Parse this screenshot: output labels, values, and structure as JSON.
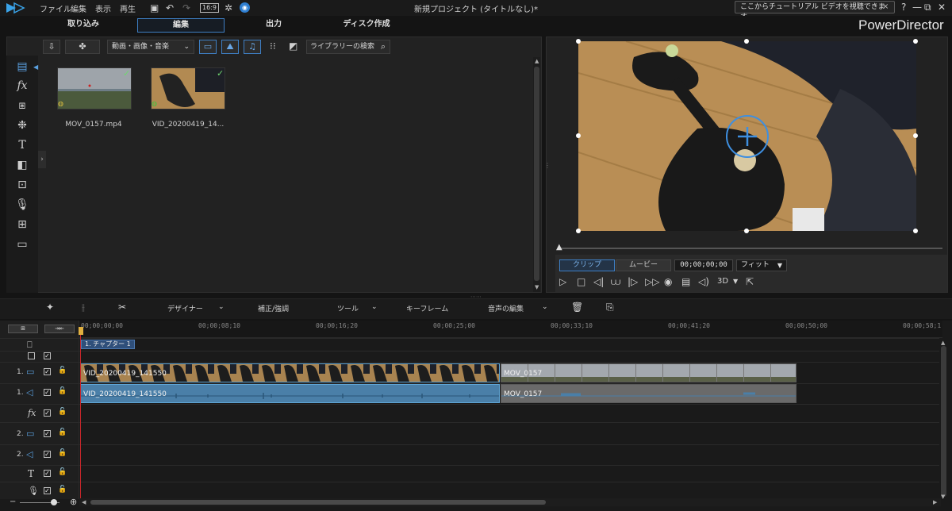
{
  "menu": [
    "ファイル",
    "編集",
    "表示",
    "再生"
  ],
  "window_title": "新規プロジェクト (タイトルなし)*",
  "tutorial": {
    "text": "ここからチュートリアル ビデオを視聴できます。",
    "close": "×"
  },
  "window_controls": {
    "help": "?",
    "minimize": "—",
    "restore": "⧉",
    "close": "✕"
  },
  "aspect_ratio": "16:9",
  "modes": [
    "取り込み",
    "編集",
    "出力",
    "ディスク作成"
  ],
  "brand": "PowerDirector",
  "library": {
    "filter_label": "動画・画像・音楽",
    "search_placeholder": "ライブラリーの検索",
    "items": [
      {
        "label": "MOV_0157.mp4"
      },
      {
        "label": "VID_20200419_14..."
      }
    ]
  },
  "preview": {
    "clip_tab": "クリップ",
    "movie_tab": "ムービー",
    "timecode": "00;00;00;00",
    "fit": "フィット",
    "mode_3d": "3D"
  },
  "edit_toolbar": {
    "designer": "デザイナー",
    "correction": "補正/強調",
    "tools": "ツール",
    "keyframe": "キーフレーム",
    "audio_edit": "音声の編集"
  },
  "timeline": {
    "ruler_labels": [
      "00;00;00;00",
      "00;00;08;10",
      "00;00;16;20",
      "00;00;25;00",
      "00;00;33;10",
      "00;00;41;20",
      "00;00;50;00",
      "00;00;58;1"
    ],
    "chapter": "1. チャプター 1",
    "tracks": [
      {
        "num": "1.",
        "type": "video"
      },
      {
        "num": "1.",
        "type": "audio"
      },
      {
        "num": "",
        "type": "fx"
      },
      {
        "num": "2.",
        "type": "video"
      },
      {
        "num": "2.",
        "type": "audio"
      },
      {
        "num": "",
        "type": "title"
      },
      {
        "num": "",
        "type": "voice"
      }
    ],
    "clips": {
      "video1_a": "VID_20200419_141550",
      "video1_b": "MOV_0157",
      "audio1_a": "VID_20200419_141550",
      "audio1_b": "MOV_0157"
    }
  },
  "colors": {
    "accent": "#3e7fc4",
    "clip_video_border": "#5fa6d6",
    "clip_audio": "#4a7fa8",
    "playhead": "#c7262b"
  }
}
